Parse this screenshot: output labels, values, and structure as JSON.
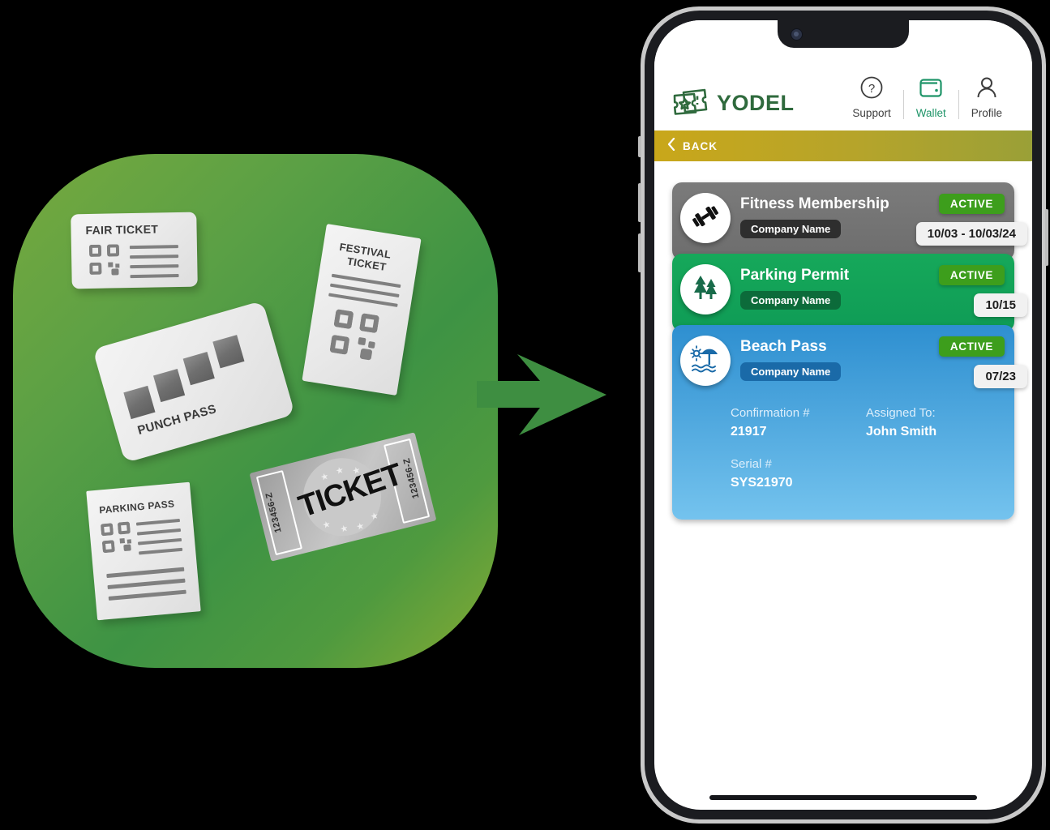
{
  "illustration": {
    "tickets": [
      {
        "id": "fair-ticket",
        "label": "FAIR TICKET"
      },
      {
        "id": "punch-pass",
        "label": "PUNCH PASS"
      },
      {
        "id": "festival-ticket",
        "label_line1": "FESTIVAL",
        "label_line2": "TICKET"
      },
      {
        "id": "parking-pass",
        "label": "PARKING PASS"
      },
      {
        "id": "big-ticket",
        "label": "TICKET",
        "serial_left": "123456-Z",
        "serial_right": "123456-Z"
      }
    ],
    "arrow": {
      "name": "right-arrow",
      "color": "#3e8e41"
    },
    "backdrop_color": "#5ba045"
  },
  "app": {
    "brand": {
      "name": "YODEL",
      "logo_icon": "tickets-star-icon",
      "color": "#2f6a3d"
    },
    "header_actions": [
      {
        "label": "Support",
        "icon": "question-circle-icon",
        "active": false
      },
      {
        "label": "Wallet",
        "icon": "wallet-icon",
        "active": true
      },
      {
        "label": "Profile",
        "icon": "person-icon",
        "active": false
      }
    ],
    "back_bar": {
      "label": "BACK",
      "icon": "chevron-left-icon"
    },
    "passes": [
      {
        "title": "Fitness Membership",
        "company": "Company Name",
        "status": "ACTIVE",
        "date": "10/03 - 10/03/24",
        "icon": "dumbbell-icon",
        "theme": "grey",
        "expanded": false
      },
      {
        "title": "Parking Permit",
        "company": "Company Name",
        "status": "ACTIVE",
        "date": "10/15",
        "icon": "trees-icon",
        "theme": "green",
        "expanded": false
      },
      {
        "title": "Beach Pass",
        "company": "Company Name",
        "status": "ACTIVE",
        "date": "07/23",
        "icon": "beach-umbrella-icon",
        "theme": "blue",
        "expanded": true,
        "details": {
          "confirmation_label": "Confirmation #",
          "confirmation_value": "21917",
          "assigned_label": "Assigned To:",
          "assigned_value": "John Smith",
          "serial_label": "Serial #",
          "serial_value": "SYS21970"
        }
      }
    ]
  }
}
